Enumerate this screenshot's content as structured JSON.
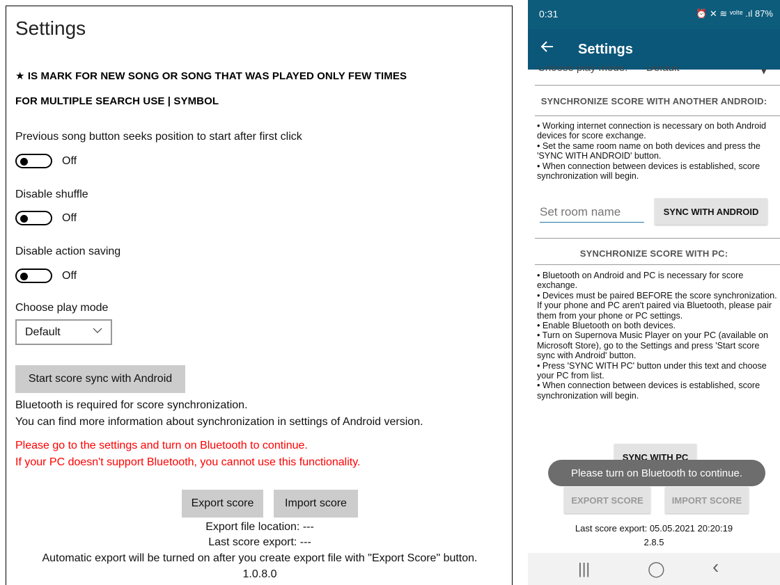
{
  "windows": {
    "title": "Settings",
    "notice_star": "★ IS MARK FOR NEW SONG OR SONG THAT WAS PLAYED ONLY FEW TIMES",
    "notice_search": "FOR MULTIPLE SEARCH USE | SYMBOL",
    "settings": [
      {
        "label": "Previous song button seeks position to start after first click",
        "state": "Off"
      },
      {
        "label": "Disable shuffle",
        "state": "Off"
      },
      {
        "label": "Disable action saving",
        "state": "Off"
      }
    ],
    "play_mode_label": "Choose play mode",
    "play_mode_value": "Default",
    "sync_button": "Start score sync with Android",
    "info_line1": "Bluetooth is required for score synchronization.",
    "info_line2": "You can find more information about synchronization in settings of Android version.",
    "error_line1": "Please go to the settings and turn on Bluetooth to continue.",
    "error_line2": "If your PC doesn't support Bluetooth, you cannot use this functionality.",
    "export_button": "Export score",
    "import_button": "Import score",
    "export_location": "Export file location: ---",
    "last_export": "Last score export: ---",
    "auto_export_note": "Automatic export will be turned on after you create export file with \"Export Score\" button.",
    "version": "1.0.8.0"
  },
  "android": {
    "status_time": "0:31",
    "status_icons": "⏰ ✕ ≋ ᵛᵒˡᵗᵉ .ıl 87%",
    "title": "Settings",
    "cut_label": "Choose play mode:",
    "cut_value": "Default",
    "sync_android_header": "SYNCHRONIZE SCORE WITH ANOTHER ANDROID:",
    "sync_android_text": [
      "• Working internet connection is necessary on both Android devices for score exchange.",
      "• Set the same room name on both devices and press the 'SYNC WITH ANDROID' button.",
      "• When connection between devices is established, score synchronization will begin."
    ],
    "room_placeholder": "Set room name",
    "sync_android_button": "SYNC WITH ANDROID",
    "sync_pc_header": "SYNCHRONIZE SCORE WITH PC:",
    "sync_pc_text": [
      "• Bluetooth on Android and PC is necessary for score exchange.",
      "• Devices must be paired BEFORE the score synchronization. If your phone and PC aren't paired via Bluetooth, please pair them from your phone or PC settings.",
      "• Enable Bluetooth on both devices.",
      "• Turn on Supernova Music Player on your PC (available on Microsoft Store), go to the Settings and press 'Start score sync with Android' button.",
      "• Press 'SYNC WITH PC' button under this text and choose your PC from list.",
      "• When connection between devices is established, score synchronization will begin."
    ],
    "sync_pc_button": "SYNC WITH PC",
    "export_button": "EXPORT SCORE",
    "import_button": "IMPORT SCORE",
    "toast": "Please turn on Bluetooth to continue.",
    "last_export": "Last score export: 05.05.2021 20:20:19",
    "version": "2.8.5",
    "nav": {
      "recents": "|||",
      "home": "◯",
      "back": "‹"
    }
  }
}
